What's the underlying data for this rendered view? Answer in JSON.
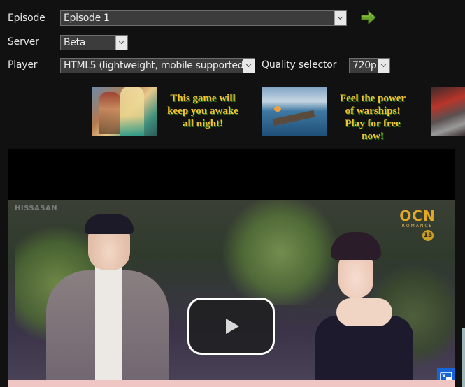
{
  "controls": {
    "episode": {
      "label": "Episode",
      "selected": "Episode 1"
    },
    "server": {
      "label": "Server",
      "selected": "Beta"
    },
    "player": {
      "label": "Player",
      "selected": "HTML5 (lightweight, mobile supported)"
    },
    "quality": {
      "label": "Quality selector",
      "selected": "720p"
    },
    "go_icon": "arrow-right-icon"
  },
  "ads": [
    {
      "image": "fantasy-game-characters",
      "text_lines": [
        "This game will",
        "keep you awake",
        "all night!"
      ]
    },
    {
      "image": "warship-battle",
      "text_lines": [
        "Feel the power",
        "of warships!",
        "Play for free",
        "now!"
      ]
    },
    {
      "image": "fiery-battle-scene"
    }
  ],
  "video": {
    "watermark": "HISSASAN",
    "channel_logo": "OCN",
    "channel_sub": "ROMANCE",
    "rating": "15",
    "play_icon": "play-icon",
    "pip_icon": "picture-in-picture-icon"
  },
  "colors": {
    "accent_ad_text": "#f1c232",
    "go_arrow": "#6aa52a",
    "pip_button": "#1565d8",
    "background": "#111111"
  }
}
